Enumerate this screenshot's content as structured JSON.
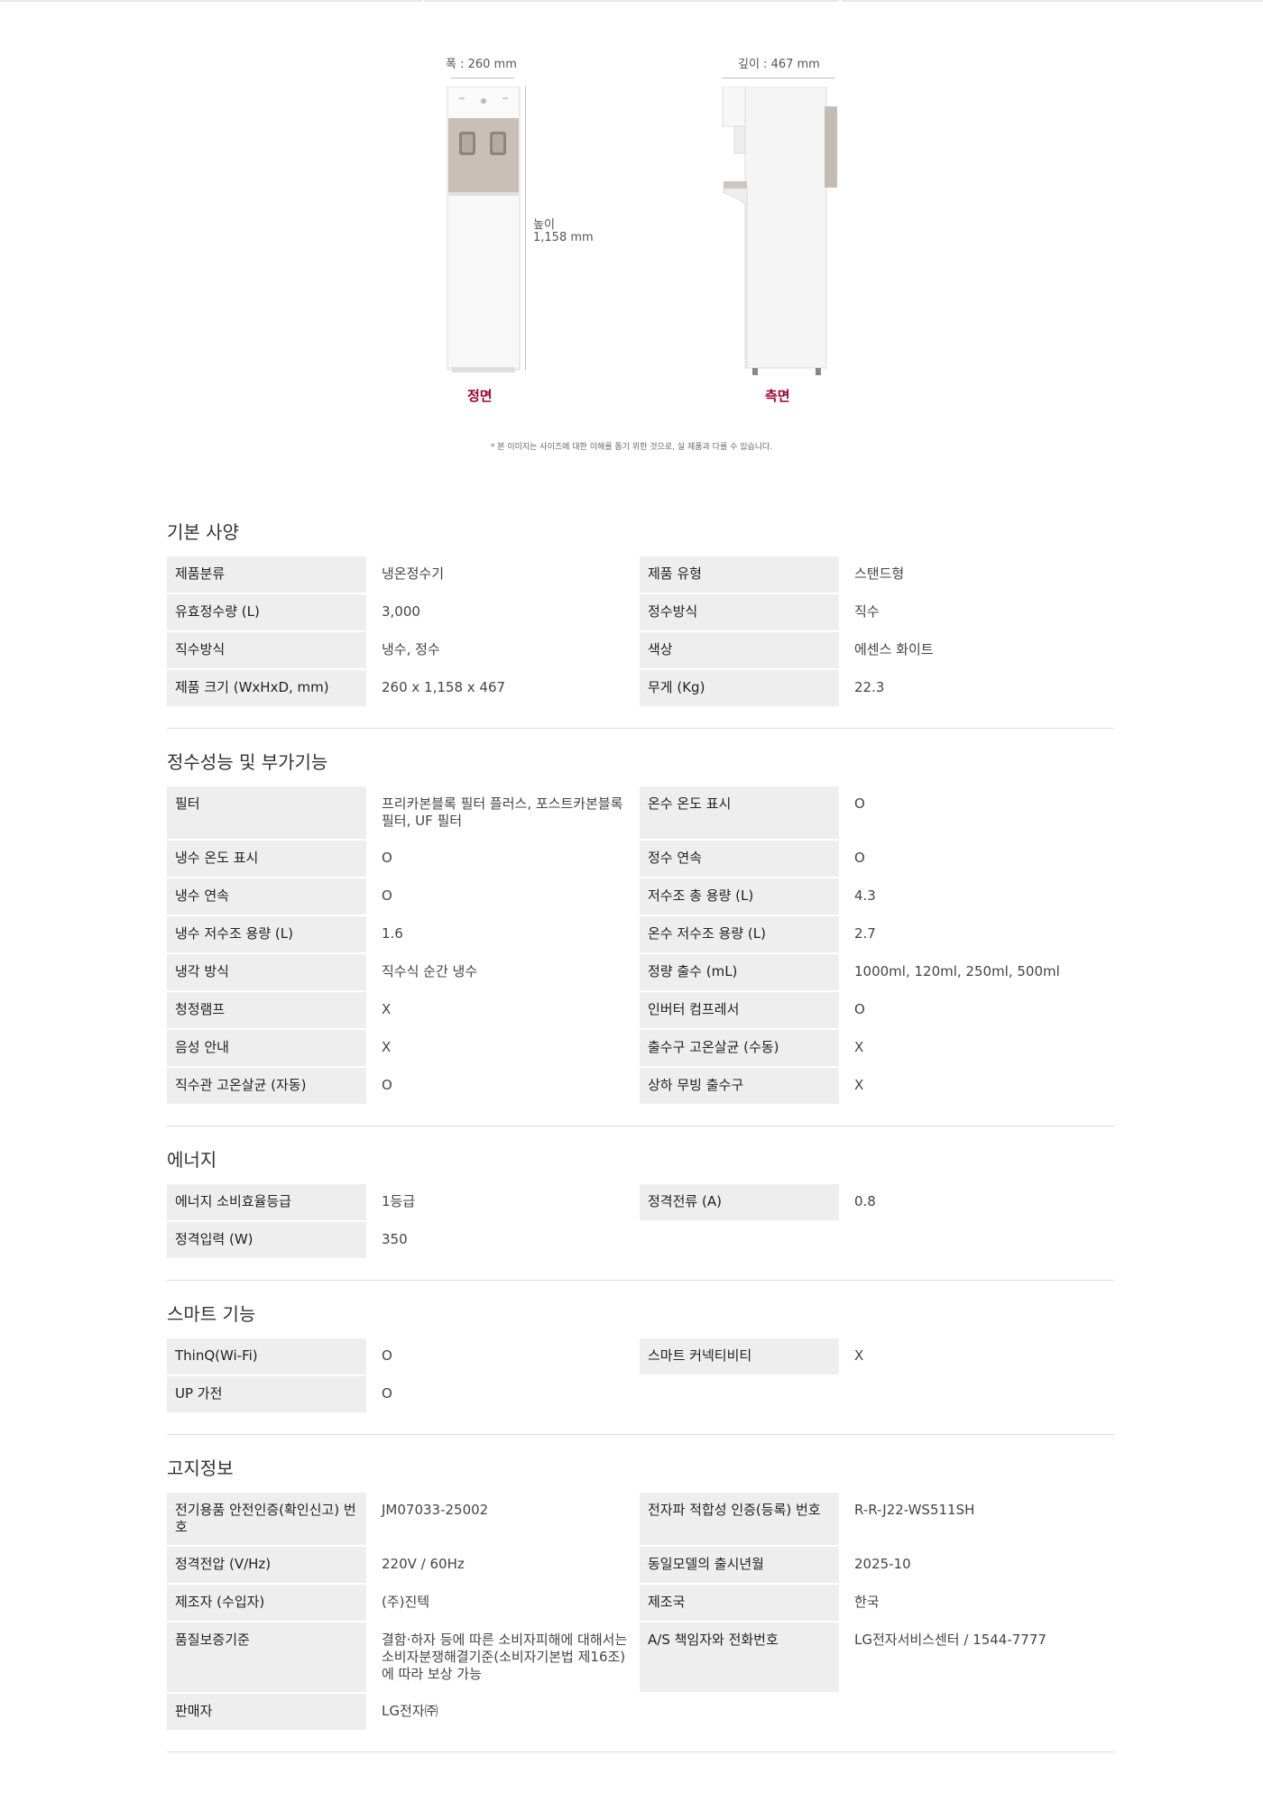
{
  "dimensions": {
    "width_label": "폭 : 260 mm",
    "depth_label": "깊이 : 467 mm",
    "height_label_1": "높이",
    "height_label_2": "1,158 mm",
    "front_label": "정면",
    "side_label": "측면",
    "disclaimer": "* 본 이미지는 사이즈에 대한 이해를 돕기 위한 것으로, 실 제품과 다를 수 있습니다."
  },
  "sections": [
    {
      "title": "기본 사양",
      "rows": [
        [
          "제품분류",
          "냉온정수기",
          "제품 유형",
          "스탠드형"
        ],
        [
          "유효정수량 (L)",
          "3,000",
          "정수방식",
          "직수"
        ],
        [
          "직수방식",
          "냉수, 정수",
          "색상",
          "에센스 화이트"
        ],
        [
          "제품 크기 (WxHxD, mm)",
          "260 x 1,158 x 467",
          "무게 (Kg)",
          "22.3"
        ]
      ]
    },
    {
      "title": "정수성능 및 부가기능",
      "rows": [
        [
          "필터",
          "프리카본블록 필터 플러스, 포스트카본블록 필터, UF 필터",
          "온수 온도 표시",
          "O"
        ],
        [
          "냉수 온도 표시",
          "O",
          "정수 연속",
          "O"
        ],
        [
          "냉수 연속",
          "O",
          "저수조 총 용량 (L)",
          "4.3"
        ],
        [
          "냉수 저수조 용량 (L)",
          "1.6",
          "온수 저수조 용량 (L)",
          "2.7"
        ],
        [
          "냉각 방식",
          "직수식 순간 냉수",
          "정량 출수 (mL)",
          "1000ml, 120ml, 250ml, 500ml"
        ],
        [
          "청정램프",
          "X",
          "인버터 컴프레서",
          "O"
        ],
        [
          "음성 안내",
          "X",
          "출수구 고온살균 (수동)",
          "X"
        ],
        [
          "직수관 고온살균 (자동)",
          "O",
          "상하 무빙 출수구",
          "X"
        ]
      ]
    },
    {
      "title": "에너지",
      "rows": [
        [
          "에너지 소비효율등급",
          "1등급",
          "정격전류 (A)",
          "0.8"
        ],
        [
          "정격입력 (W)",
          "350",
          "",
          ""
        ]
      ]
    },
    {
      "title": "스마트 기능",
      "rows": [
        [
          "ThinQ(Wi-Fi)",
          "O",
          "스마트 커넥티비티",
          "X"
        ],
        [
          "UP 가전",
          "O",
          "",
          ""
        ]
      ]
    },
    {
      "title": "고지정보",
      "rows": [
        [
          "전기용품 안전인증(확인신고) 번호",
          "JM07033-25002",
          "전자파 적합성 인증(등록) 번호",
          "R-R-J22-WS511SH"
        ],
        [
          "정격전압 (V/Hz)",
          "220V / 60Hz",
          "동일모델의 출시년월",
          "2025-10"
        ],
        [
          "제조자 (수입자)",
          "(주)진텍",
          "제조국",
          "한국"
        ],
        [
          "품질보증기준",
          "결함·하자 등에 따른 소비자피해에 대해서는 소비자분쟁해결기준(소비자기본법 제16조)에 따라 보상 가능",
          "A/S 책임자와 전화번호",
          "LG전자서비스센터 / 1544-7777"
        ],
        [
          "판매자",
          "LG전자㈜",
          "",
          ""
        ]
      ]
    }
  ]
}
